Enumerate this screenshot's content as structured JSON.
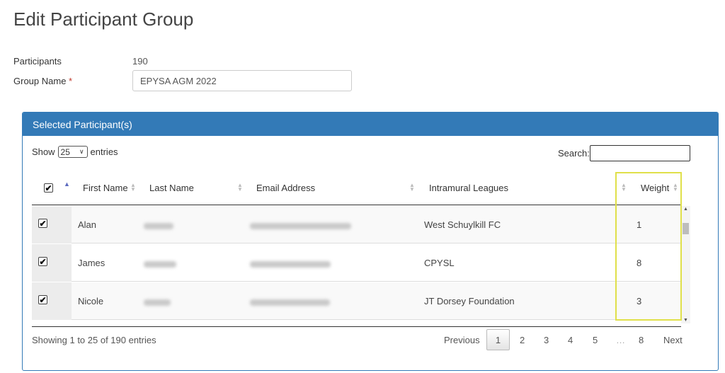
{
  "page": {
    "title": "Edit Participant Group"
  },
  "form": {
    "participants_label": "Participants",
    "participants_value": "190",
    "group_name_label": "Group Name",
    "required_mark": "*",
    "group_name_value": "EPYSA AGM 2022"
  },
  "panel": {
    "title": "Selected Participant(s)",
    "show_label": "Show",
    "page_length": "25",
    "entries_label": "entries",
    "search_label": "Search:",
    "search_value": ""
  },
  "table": {
    "columns": [
      "First Name",
      "Last Name",
      "Email Address",
      "Intramural Leagues",
      "Weight"
    ],
    "select_all_checked": true,
    "rows": [
      {
        "checked": true,
        "first_name": "Alan",
        "league": "West Schuylkill FC",
        "weight": "1"
      },
      {
        "checked": true,
        "first_name": "James",
        "league": "CPYSL",
        "weight": "8"
      },
      {
        "checked": true,
        "first_name": "Nicole",
        "league": "JT Dorsey Foundation",
        "weight": "3"
      }
    ]
  },
  "footer": {
    "info": "Showing 1 to 25 of 190 entries",
    "previous": "Previous",
    "pages": [
      "1",
      "2",
      "3",
      "4",
      "5",
      "…",
      "8"
    ],
    "active_page": "1",
    "next": "Next"
  },
  "colors": {
    "panel_header": "#337ab7",
    "highlight_border": "#e0e04a",
    "required": "#c0392b"
  }
}
